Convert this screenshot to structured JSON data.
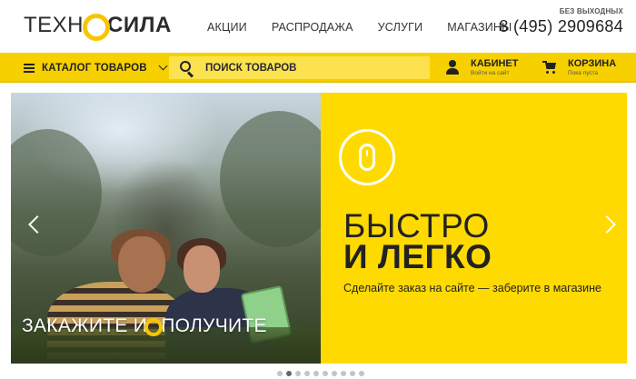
{
  "logo": {
    "part1": "ТЕХН",
    "part2": "СИЛА"
  },
  "nav": [
    "АКЦИИ",
    "РАСПРОДАЖА",
    "УСЛУГИ",
    "МАГАЗИНЫ"
  ],
  "phone": {
    "note": "БЕЗ ВЫХОДНЫХ",
    "number": "8 (495) 2909684"
  },
  "toolbar": {
    "catalog_label": "КАТАЛОГ ТОВАРОВ",
    "search_placeholder": "ПОИСК ТОВАРОВ",
    "cabinet_title": "КАБИНЕТ",
    "cabinet_sub": "Войти на сайт",
    "cart_title": "КОРЗИНА",
    "cart_sub": "Пока пуста"
  },
  "banner": {
    "slogan_left": "ЗАКАЖИТЕ И",
    "slogan_right": "ПОЛУЧИТЕ",
    "headline_line1": "БЫСТРО",
    "headline_line2": "И ЛЕГКО",
    "subline": "Сделайте заказ на сайте — заберите в магазине"
  },
  "slider": {
    "total": 10,
    "active_index": 1
  },
  "colors": {
    "brand_yellow": "#ffda00",
    "toolbar_yellow": "#f7d000",
    "text_dark": "#222222"
  },
  "icons": [
    "menu-icon",
    "chevron-down-icon",
    "search-icon",
    "user-icon",
    "cart-icon",
    "mouse-icon",
    "arrow-left-icon",
    "arrow-right-icon"
  ]
}
